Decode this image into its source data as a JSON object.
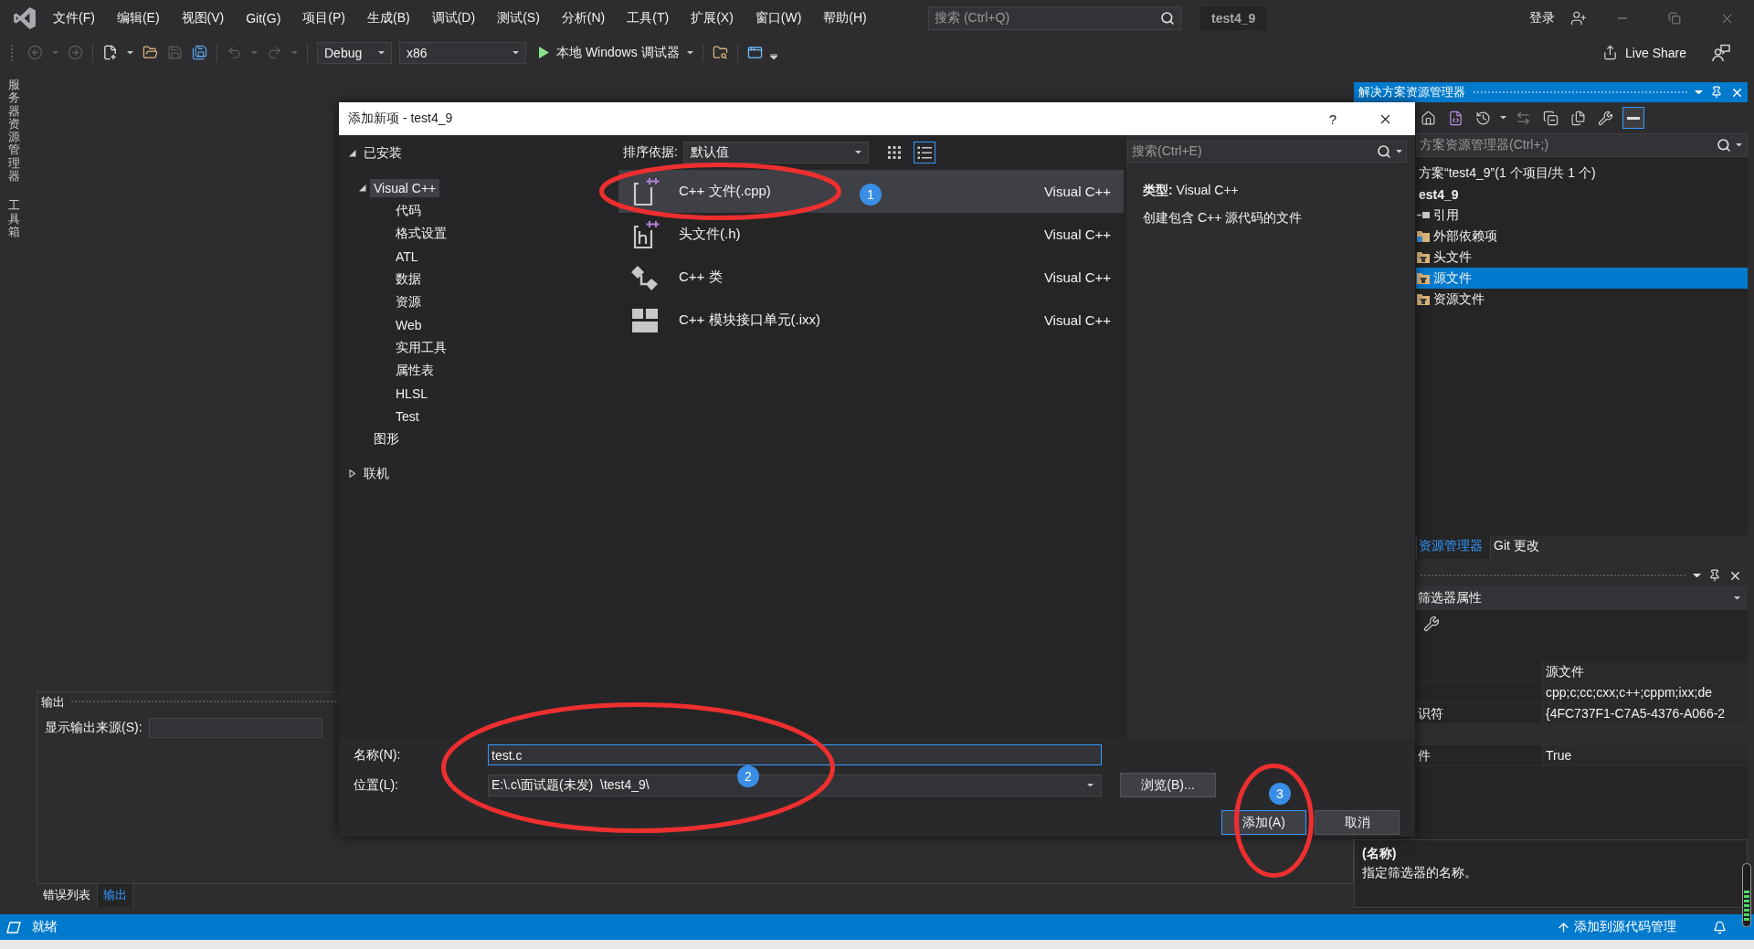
{
  "title_bar": {
    "menu": [
      "文件(F)",
      "编辑(E)",
      "视图(V)",
      "Git(G)",
      "项目(P)",
      "生成(B)",
      "调试(D)",
      "测试(S)",
      "分析(N)",
      "工具(T)",
      "扩展(X)",
      "窗口(W)",
      "帮助(H)"
    ],
    "search": {
      "placeholder": "搜索 (Ctrl+Q)"
    },
    "solution_name": "test4_9",
    "sign_in": "登录"
  },
  "toolbar": {
    "groups": [
      [
        {
          "kind": "back",
          "disabled": true,
          "dropdown": true
        },
        {
          "kind": "forward",
          "disabled": true,
          "dropdown": false
        }
      ],
      [
        {
          "kind": "new_item",
          "disabled": false,
          "dropdown": true
        },
        {
          "kind": "open",
          "disabled": false,
          "dropdown": false
        },
        {
          "kind": "save",
          "disabled": true,
          "dropdown": false
        },
        {
          "kind": "save_all",
          "disabled": false,
          "dropdown": false
        }
      ],
      [
        {
          "kind": "undo",
          "disabled": true,
          "dropdown": true
        },
        {
          "kind": "redo",
          "disabled": true,
          "dropdown": true
        }
      ]
    ],
    "configuration": "Debug",
    "platform": "x86",
    "run_label": "本地 Windows 调试器",
    "extra_buttons": [
      {
        "kind": "find_in_files"
      },
      {
        "kind": "browser"
      }
    ],
    "live_share": "Live Share"
  },
  "side_tabs": [
    "服务器资源管理器",
    "工具箱"
  ],
  "output_panel": {
    "title": "输出",
    "source_label": "显示输出来源(S):",
    "tabs": [
      {
        "label": "错误列表",
        "selected": false
      },
      {
        "label": "输出",
        "selected": true
      }
    ]
  },
  "dialog": {
    "title": "添加新项 - test4_9",
    "help": "?",
    "tree": [
      {
        "label": "已安装",
        "expanded": true,
        "selected": false,
        "children": [
          {
            "label": "Visual C++",
            "expanded": true,
            "selected": true,
            "children": [
              {
                "label": "代码",
                "selected": false
              },
              {
                "label": "格式设置",
                "selected": false
              },
              {
                "label": "ATL",
                "selected": false
              },
              {
                "label": "数据",
                "selected": false
              },
              {
                "label": "资源",
                "selected": false
              },
              {
                "label": "Web",
                "selected": false
              },
              {
                "label": "实用工具",
                "selected": false
              },
              {
                "label": "属性表",
                "selected": false
              },
              {
                "label": "HLSL",
                "selected": false
              },
              {
                "label": "Test",
                "selected": false
              }
            ]
          },
          {
            "label": "图形",
            "selected": false
          }
        ]
      },
      {
        "label": "联机",
        "expanded": false,
        "selected": false
      }
    ],
    "sort_label": "排序依据:",
    "sort_value": "默认值",
    "views": [
      {
        "kind": "grid",
        "selected": false
      },
      {
        "kind": "list",
        "selected": true
      }
    ],
    "items": [
      {
        "kind": "cpp",
        "name": "C++ 文件(.cpp)",
        "category": "Visual C++",
        "selected": true
      },
      {
        "kind": "header",
        "name": "头文件(.h)",
        "category": "Visual C++",
        "selected": false
      },
      {
        "kind": "class",
        "name": "C++ 类",
        "category": "Visual C++",
        "selected": false
      },
      {
        "kind": "module",
        "name": "C++ 模块接口单元(.ixx)",
        "category": "Visual C++",
        "selected": false
      }
    ],
    "search": {
      "placeholder": "搜索(Ctrl+E)"
    },
    "details": {
      "type": "**类型:**  Visual C++",
      "description": "创建包含 C++ 源代码的文件"
    },
    "name_label": "名称(N):",
    "name_value": "test.c",
    "location_label": "位置(L):",
    "location_value": "E:\\.c\\面试题(未发)  \\test4_9\\",
    "browse": "浏览(B)...",
    "add": "添加(A)",
    "cancel": "取消"
  },
  "solution_explorer": {
    "title": "解决方案资源管理器",
    "tools": [
      {
        "kind": "home",
        "on": false,
        "dropdown": false
      },
      {
        "kind": "switch_views",
        "on": false,
        "dropdown": false
      },
      {
        "kind": "history",
        "on": false,
        "dropdown": true
      },
      {
        "kind": "sync",
        "on": false,
        "dropdown": false
      },
      {
        "kind": "collapse",
        "on": false,
        "dropdown": false
      },
      {
        "kind": "show_all",
        "on": false,
        "dropdown": false
      },
      {
        "kind": "properties",
        "on": false,
        "dropdown": false
      },
      {
        "kind": "preview",
        "on": true,
        "dropdown": false
      }
    ],
    "search": {
      "placeholder": "方案资源管理器(Ctrl+;)"
    },
    "tree": [
      {
        "kind": "solution",
        "label": "方案“test4_9”(1 个项目/共 1 个)",
        "selected": false,
        "children": [
          {
            "kind": "project",
            "label": "est4_9",
            "selected": false,
            "children": [
              {
                "kind": "references",
                "label": "引用",
                "selected": false
              },
              {
                "kind": "dependencies",
                "label": "外部依赖项",
                "selected": false
              },
              {
                "kind": "folder",
                "label": "头文件",
                "selected": false
              },
              {
                "kind": "folder",
                "label": "源文件",
                "selected": true
              },
              {
                "kind": "folder",
                "label": "资源文件",
                "selected": false
              }
            ]
          }
        ]
      }
    ],
    "tabs": [
      {
        "label": "资源管理器",
        "selected": true
      },
      {
        "label": "Git 更改",
        "selected": false
      }
    ]
  },
  "properties": {
    "object": "筛选器属性",
    "rows": [
      {
        "kind": "property",
        "value": "源文件"
      },
      {
        "kind": "property",
        "value": "cpp;c;cc;cxx;c++;cppm;ixx;de"
      },
      {
        "kind": "property",
        "name": "识符",
        "value": "{4FC737F1-C7A5-4376-A066-2"
      },
      {
        "kind": "category"
      },
      {
        "kind": "property",
        "name": "件",
        "value": "True"
      }
    ],
    "description_title": "(名称)",
    "description": "指定筛选器的名称。"
  },
  "status_bar": {
    "state": "就绪",
    "source_control": "添加到源代码管理"
  },
  "annotations": [
    {
      "label": "1"
    },
    {
      "label": "2"
    },
    {
      "label": "3"
    }
  ]
}
